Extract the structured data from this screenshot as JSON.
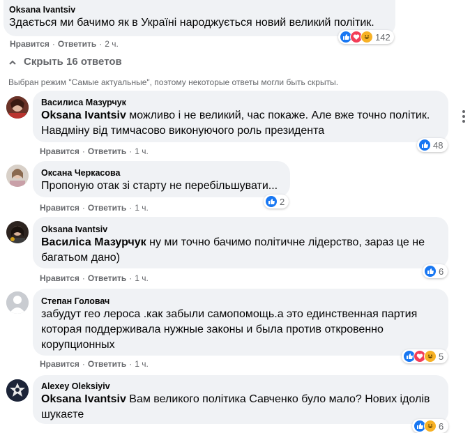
{
  "top_comment": {
    "author": "Oksana Ivantsiv",
    "text": "Здається ми бачимо як в Україні народжується новий великий політик.",
    "like": "Нравится",
    "reply": "Ответить",
    "time": "2 ч.",
    "reactions": "142"
  },
  "replies_toggle": {
    "label": "Скрыть 16 ответов"
  },
  "filter_notice": "Выбран режим \"Самые актуальные\", поэтому некоторые ответы могли быть скрыты.",
  "replies": [
    {
      "author": "Василиса Мазурчук",
      "tag": "Oksana Ivantsiv",
      "text": " можливо і не великий, час покаже. Але вже точно політик. Навдмiну від тимчасово виконуючого роль президента",
      "like": "Нравится",
      "reply": "Ответить",
      "time": "1 ч.",
      "reactions": "48"
    },
    {
      "author": "Оксана Черкасова",
      "tag": "",
      "text": "Пропоную отак зі старту не перебільшувати...",
      "like": "Нравится",
      "reply": "Ответить",
      "time": "1 ч.",
      "reactions": "2"
    },
    {
      "author": "Oksana Ivantsiv",
      "tag": "Василіса Мазурчук",
      "text": " ну ми точно бачимо політичне лідерство, зараз це не багатьом дано)",
      "like": "Нравится",
      "reply": "Ответить",
      "time": "1 ч.",
      "reactions": "6"
    },
    {
      "author": "Степан Головач",
      "tag": "",
      "text": "забудут гео лероса .как забыли самопомощь.а это единственная партия которая поддерживала нужные законы и была против откровенно корупционных",
      "like": "Нравится",
      "reply": "Ответить",
      "time": "1 ч.",
      "reactions": "5"
    },
    {
      "author": "Alexey Oleksiyiv",
      "tag": "Oksana Ivantsiv",
      "text": " Вам великого політика Савченко було мало? Нових ідолів шукаєте",
      "like": "",
      "reply": "",
      "time": "",
      "reactions": "6"
    }
  ],
  "colors": {
    "like_blue": "#1877f2",
    "love_red": "#f33e58",
    "haha_yellow": "#f7b125",
    "bubble": "#f0f2f5",
    "meta_gray": "#65676b"
  }
}
